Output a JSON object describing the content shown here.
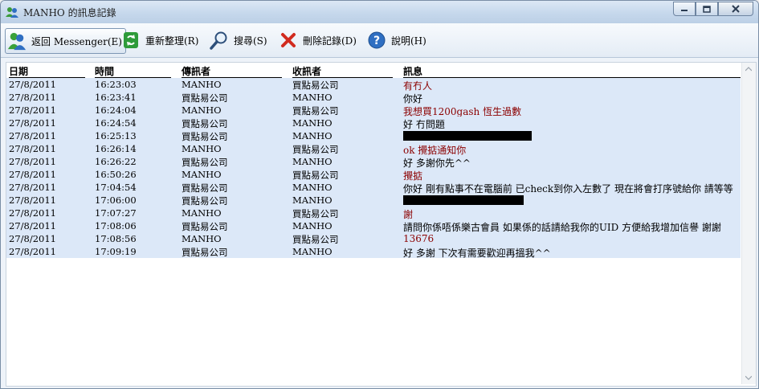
{
  "window": {
    "title": "MANHO 的訊息記錄"
  },
  "toolbar": {
    "back_label": "返回 Messenger(E)",
    "refresh_label": "重新整理(R)",
    "search_label": "搜尋(S)",
    "delete_label": "刪除記錄(D)",
    "help_label": "說明(H)"
  },
  "columns": {
    "date": "日期",
    "time": "時間",
    "sender": "傳訊者",
    "receiver": "收訊者",
    "message": "訊息"
  },
  "rows": [
    {
      "date": "27/8/2011",
      "time": "16:23:03",
      "sender": "MANHO",
      "receiver": "買點易公司",
      "message": "有冇人",
      "red": true
    },
    {
      "date": "27/8/2011",
      "time": "16:23:41",
      "sender": "買點易公司",
      "receiver": "MANHO",
      "message": "你好",
      "red": false
    },
    {
      "date": "27/8/2011",
      "time": "16:24:04",
      "sender": "MANHO",
      "receiver": "買點易公司",
      "message": "我想買1200gash 恆生過數",
      "red": true
    },
    {
      "date": "27/8/2011",
      "time": "16:24:54",
      "sender": "買點易公司",
      "receiver": "MANHO",
      "message": "好 冇問題",
      "red": false
    },
    {
      "date": "27/8/2011",
      "time": "16:25:13",
      "sender": "買點易公司",
      "receiver": "MANHO",
      "message": "",
      "red": false,
      "redact": 160
    },
    {
      "date": "27/8/2011",
      "time": "16:26:14",
      "sender": "MANHO",
      "receiver": "買點易公司",
      "message": "ok 攪掂通知你",
      "red": true
    },
    {
      "date": "27/8/2011",
      "time": "16:26:22",
      "sender": "買點易公司",
      "receiver": "MANHO",
      "message": "好 多謝你先^^",
      "red": false
    },
    {
      "date": "27/8/2011",
      "time": "16:50:26",
      "sender": "MANHO",
      "receiver": "買點易公司",
      "message": "攪掂",
      "red": true
    },
    {
      "date": "27/8/2011",
      "time": "17:04:54",
      "sender": "買點易公司",
      "receiver": "MANHO",
      "message": "你好 剛有點事不在電腦前 已check到你入左數了 現在將會打序號給你 請等等",
      "red": false
    },
    {
      "date": "27/8/2011",
      "time": "17:06:00",
      "sender": "買點易公司",
      "receiver": "MANHO",
      "message": "",
      "red": false,
      "redact": 150
    },
    {
      "date": "27/8/2011",
      "time": "17:07:27",
      "sender": "MANHO",
      "receiver": "買點易公司",
      "message": "謝",
      "red": true
    },
    {
      "date": "27/8/2011",
      "time": "17:08:06",
      "sender": "買點易公司",
      "receiver": "MANHO",
      "message": "請問你係唔係樂古會員 如果係的話請給我你的UID 方便給我增加信譽 謝謝",
      "red": false
    },
    {
      "date": "27/8/2011",
      "time": "17:08:56",
      "sender": "MANHO",
      "receiver": "買點易公司",
      "message": "13676",
      "red": true
    },
    {
      "date": "27/8/2011",
      "time": "17:09:19",
      "sender": "買點易公司",
      "receiver": "MANHO",
      "message": "好 多謝 下次有需要歡迎再搵我^^",
      "red": false
    }
  ]
}
